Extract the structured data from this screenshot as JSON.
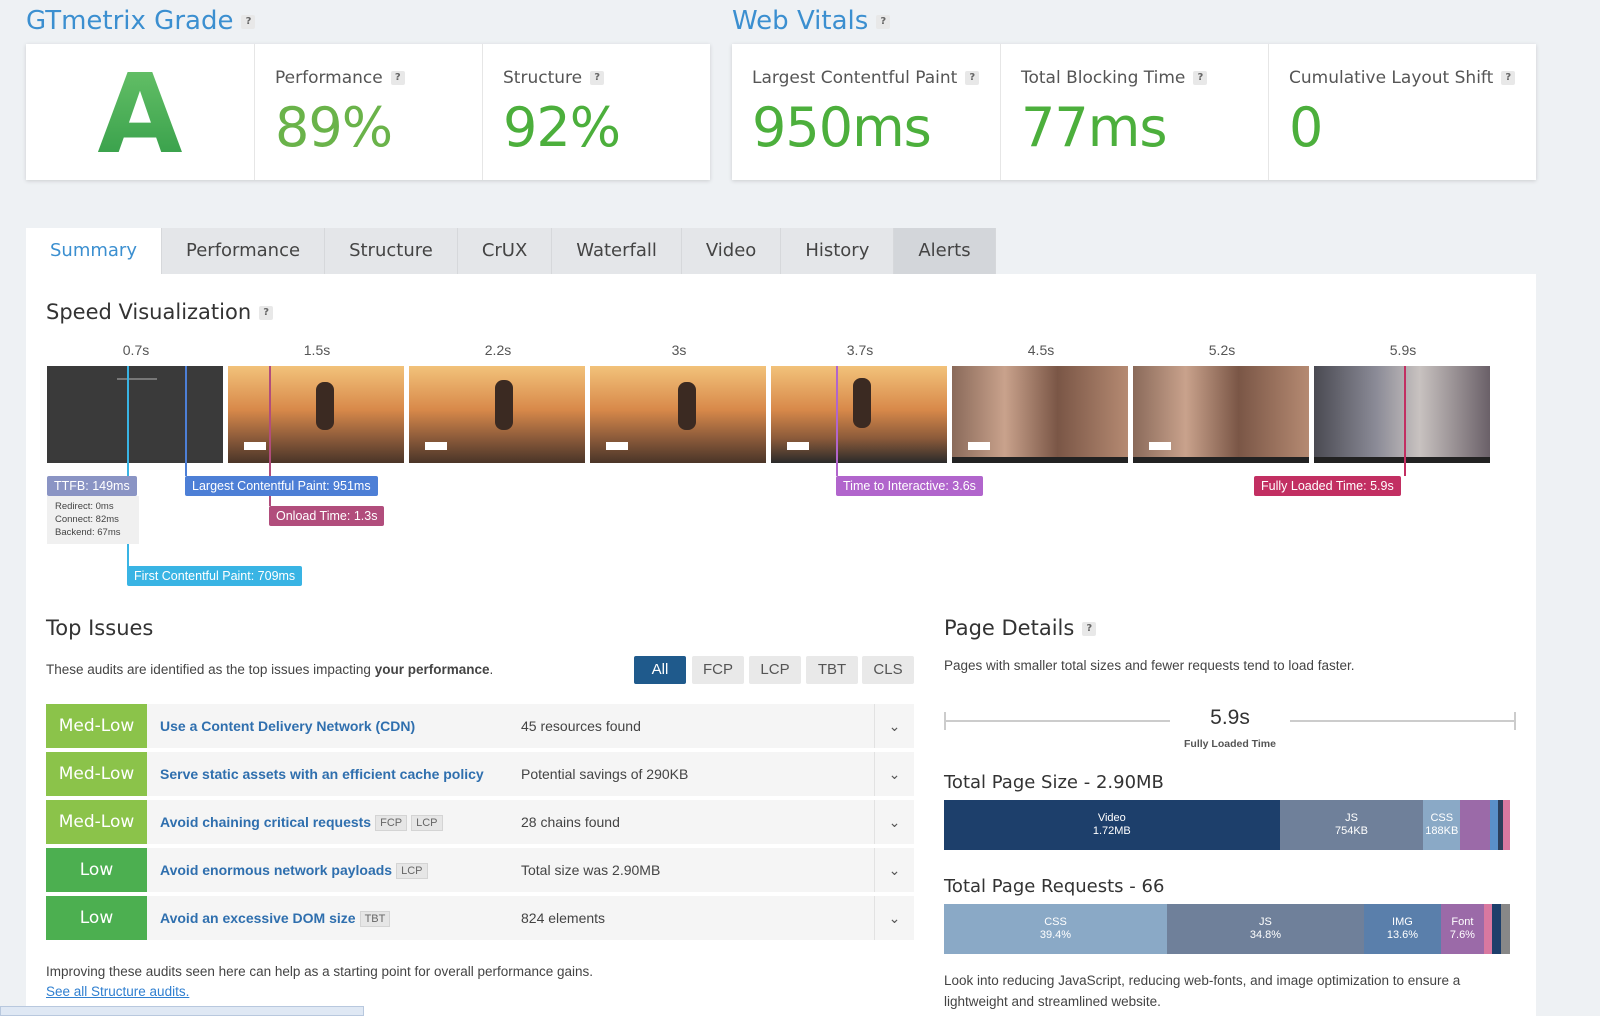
{
  "grade": {
    "title": "GTmetrix Grade",
    "letter": "A",
    "performance_label": "Performance",
    "performance_value": "89%",
    "structure_label": "Structure",
    "structure_value": "92%"
  },
  "vitals": {
    "title": "Web Vitals",
    "lcp_label": "Largest Contentful Paint",
    "lcp_value": "950ms",
    "tbt_label": "Total Blocking Time",
    "tbt_value": "77ms",
    "cls_label": "Cumulative Layout Shift",
    "cls_value": "0"
  },
  "tabs": [
    "Summary",
    "Performance",
    "Structure",
    "CrUX",
    "Waterfall",
    "Video",
    "History",
    "Alerts"
  ],
  "speed": {
    "title": "Speed Visualization",
    "times": [
      "0.7s",
      "1.5s",
      "2.2s",
      "3s",
      "3.7s",
      "4.5s",
      "5.2s",
      "5.9s"
    ],
    "ttfb": "TTFB: 149ms",
    "ttfb_details": [
      "Redirect: 0ms",
      "Connect: 82ms",
      "Backend: 67ms"
    ],
    "lcp": "Largest Contentful Paint: 951ms",
    "onload": "Onload Time: 1.3s",
    "tti": "Time to Interactive: 3.6s",
    "fully_loaded": "Fully Loaded Time: 5.9s",
    "fcp": "First Contentful Paint: 709ms",
    "colors": {
      "ttfb": "#8a94c4",
      "lcp": "#4d7fd6",
      "onload": "#b14d7c",
      "tti": "#b165cc",
      "fully": "#c22f62",
      "fcp": "#39b4e4"
    }
  },
  "issues": {
    "title": "Top Issues",
    "intro_prefix": "These audits are identified as the top issues impacting ",
    "intro_bold": "your performance",
    "intro_suffix": ".",
    "filters": [
      "All",
      "FCP",
      "LCP",
      "TBT",
      "CLS"
    ],
    "rows": [
      {
        "severity": "Med-Low",
        "title": "Use a Content Delivery Network (CDN)",
        "tags": [],
        "desc": "45 resources found"
      },
      {
        "severity": "Med-Low",
        "title": "Serve static assets with an efficient cache policy",
        "tags": [],
        "desc": "Potential savings of 290KB"
      },
      {
        "severity": "Med-Low",
        "title": "Avoid chaining critical requests",
        "tags": [
          "FCP",
          "LCP"
        ],
        "desc": "28 chains found"
      },
      {
        "severity": "Low",
        "title": "Avoid enormous network payloads",
        "tags": [
          "LCP"
        ],
        "desc": "Total size was 2.90MB"
      },
      {
        "severity": "Low",
        "title": "Avoid an excessive DOM size",
        "tags": [
          "TBT"
        ],
        "desc": "824 elements"
      }
    ],
    "footer": "Improving these audits seen here can help as a starting point for overall performance gains.",
    "link": "See all Structure audits."
  },
  "details": {
    "title": "Page Details",
    "intro": "Pages with smaller total sizes and fewer requests tend to load faster.",
    "fully_value": "5.9s",
    "fully_label": "Fully Loaded Time",
    "size_title": "Total Page Size - 2.90MB",
    "size_segments": [
      {
        "label": "Video",
        "value": "1.72MB",
        "share": 0.593,
        "color": "#1d3f6b"
      },
      {
        "label": "JS",
        "value": "754KB",
        "share": 0.254,
        "color": "#6f809a"
      },
      {
        "label": "CSS",
        "value": "188KB",
        "share": 0.065,
        "color": "#8aa9c6"
      },
      {
        "label": "",
        "value": "",
        "share": 0.052,
        "color": "#9b6aa8"
      },
      {
        "label": "",
        "value": "",
        "share": 0.015,
        "color": "#5a8fc8"
      },
      {
        "label": "",
        "value": "",
        "share": 0.008,
        "color": "#2c3e5a"
      },
      {
        "label": "",
        "value": "",
        "share": 0.013,
        "color": "#d978a0"
      }
    ],
    "req_title": "Total Page Requests - 66",
    "req_segments": [
      {
        "label": "CSS",
        "value": "39.4%",
        "share": 0.394,
        "color": "#8aa9c6"
      },
      {
        "label": "JS",
        "value": "34.8%",
        "share": 0.348,
        "color": "#6f809a"
      },
      {
        "label": "IMG",
        "value": "13.6%",
        "share": 0.136,
        "color": "#5a7fab"
      },
      {
        "label": "Font",
        "value": "7.6%",
        "share": 0.076,
        "color": "#9b6aa8"
      },
      {
        "label": "",
        "value": "",
        "share": 0.015,
        "color": "#d978a0"
      },
      {
        "label": "",
        "value": "",
        "share": 0.015,
        "color": "#1d3f6b"
      },
      {
        "label": "",
        "value": "",
        "share": 0.016,
        "color": "#888888"
      }
    ],
    "footer": "Look into reducing JavaScript, reducing web-fonts, and image optimization to ensure a lightweight and streamlined website."
  },
  "colors": {
    "accent": "#3b8fd0",
    "good": "#4caf3c",
    "medlow": "#8bc34a",
    "low": "#4caf50",
    "filter_active": "#1f5a8c"
  }
}
